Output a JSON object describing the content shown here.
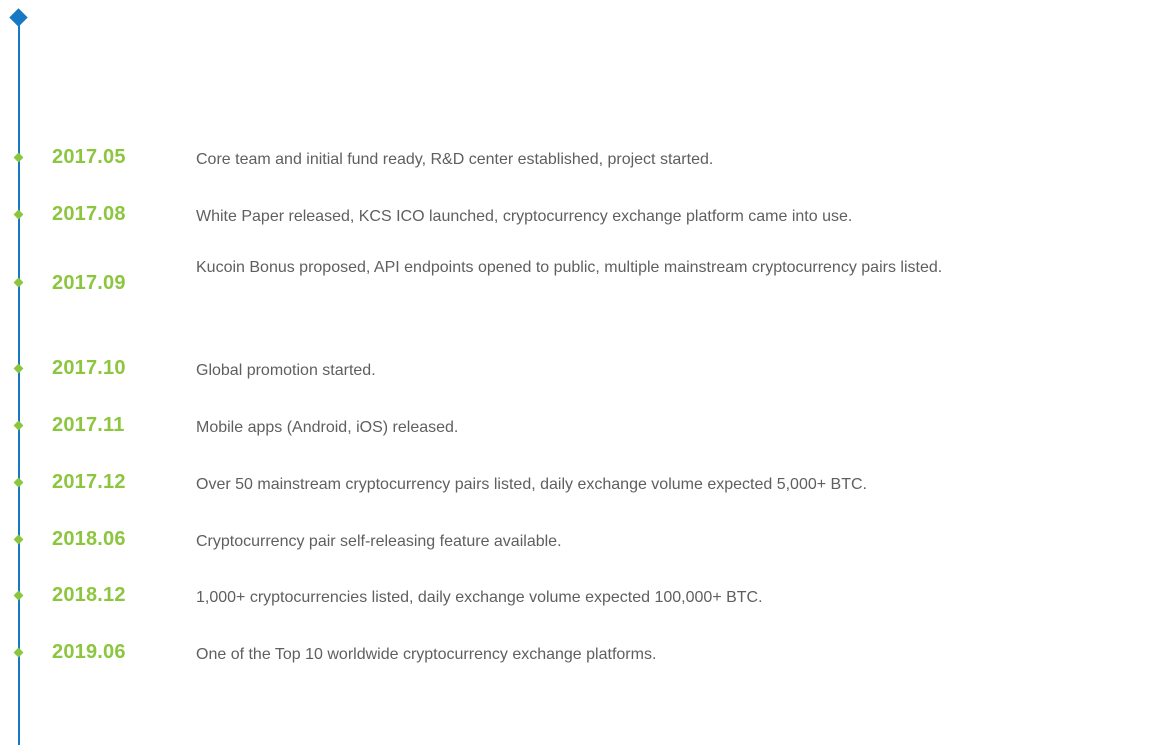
{
  "colors": {
    "axis": "#1778c4",
    "marker": "#1778c4",
    "dot": "#8cc63f",
    "date": "#8cc63f",
    "text": "#5f5f5f"
  },
  "timeline": {
    "entries": [
      {
        "date": "2017.05",
        "text": "Core team and initial fund ready, R&D center established, project started."
      },
      {
        "date": "2017.08",
        "text": "White Paper released, KCS ICO launched, cryptocurrency exchange platform came into use."
      },
      {
        "date": "2017.09",
        "text": "Kucoin Bonus proposed, API endpoints opened to public, multiple mainstream cryptocurrency pairs listed."
      },
      {
        "date": "2017.10",
        "text": "Global promotion started."
      },
      {
        "date": "2017.11",
        "text": "Mobile apps (Android, iOS) released."
      },
      {
        "date": "2017.12",
        "text": "Over 50 mainstream cryptocurrency pairs listed, daily exchange volume expected 5,000+ BTC."
      },
      {
        "date": "2018.06",
        "text": "Cryptocurrency pair self-releasing feature available."
      },
      {
        "date": "2018.12",
        "text": "1,000+ cryptocurrencies listed, daily exchange volume expected 100,000+ BTC."
      },
      {
        "date": "2019.06",
        "text": "One of the Top 10 worldwide cryptocurrency exchange platforms."
      }
    ]
  }
}
